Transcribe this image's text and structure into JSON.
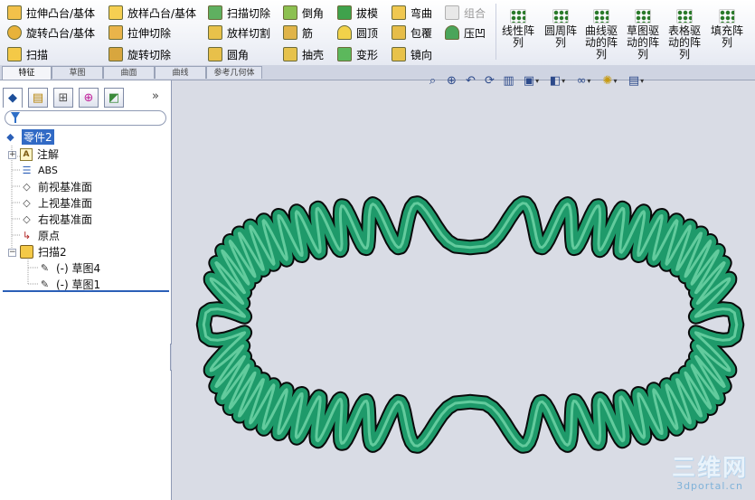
{
  "ribbon": {
    "col1": [
      "拉伸凸台/基体",
      "旋转凸台/基体",
      "扫描"
    ],
    "col2": [
      "放样凸台/基体",
      "拉伸切除",
      "旋转切除"
    ],
    "col3": [
      "扫描切除",
      "放样切割",
      "圆角"
    ],
    "col4": [
      "倒角",
      "筋",
      "抽壳"
    ],
    "col5": [
      "拔模",
      "圆顶",
      "变形"
    ],
    "col6": [
      "弯曲",
      "包覆",
      "镜向"
    ],
    "col7": [
      "组合",
      "压凹"
    ],
    "patterns": [
      {
        "line1": "线性阵",
        "line2": "列"
      },
      {
        "line1": "圆周阵",
        "line2": "列"
      },
      {
        "line1": "曲线驱",
        "line2": "动的阵",
        "line3": "列"
      },
      {
        "line1": "草图驱",
        "line2": "动的阵",
        "line3": "列"
      },
      {
        "line1": "表格驱",
        "line2": "动的阵",
        "line3": "列"
      },
      {
        "line1": "填充阵",
        "line2": "列"
      }
    ]
  },
  "tabs": [
    "特征",
    "草图",
    "曲面",
    "曲线",
    "参考几何体"
  ],
  "tree": {
    "part": "零件2",
    "annotations": "注解",
    "material": "ABS",
    "front_plane": "前视基准面",
    "top_plane": "上视基准面",
    "right_plane": "右视基准面",
    "origin": "原点",
    "sweep": "扫描2",
    "sketch4": "(-) 草图4",
    "sketch1": "(-) 草图1"
  },
  "panel": {
    "collapse_label": "»"
  },
  "viewport": {
    "model_color": "#1e9a6a",
    "toolbar_icons": [
      "zoom-fit-icon",
      "zoom-area-icon",
      "previous-view-icon",
      "rotate-icon",
      "section-view-icon",
      "view-orientation-icon",
      "display-style-icon",
      "hide-show-icon",
      "edit-appearance-icon",
      "apply-scene-icon"
    ]
  },
  "watermark": {
    "logo": "三维网",
    "url": "3dportal.cn"
  },
  "colors": {
    "selection": "#316ac5",
    "accent_blue": "#2b5fb7"
  }
}
